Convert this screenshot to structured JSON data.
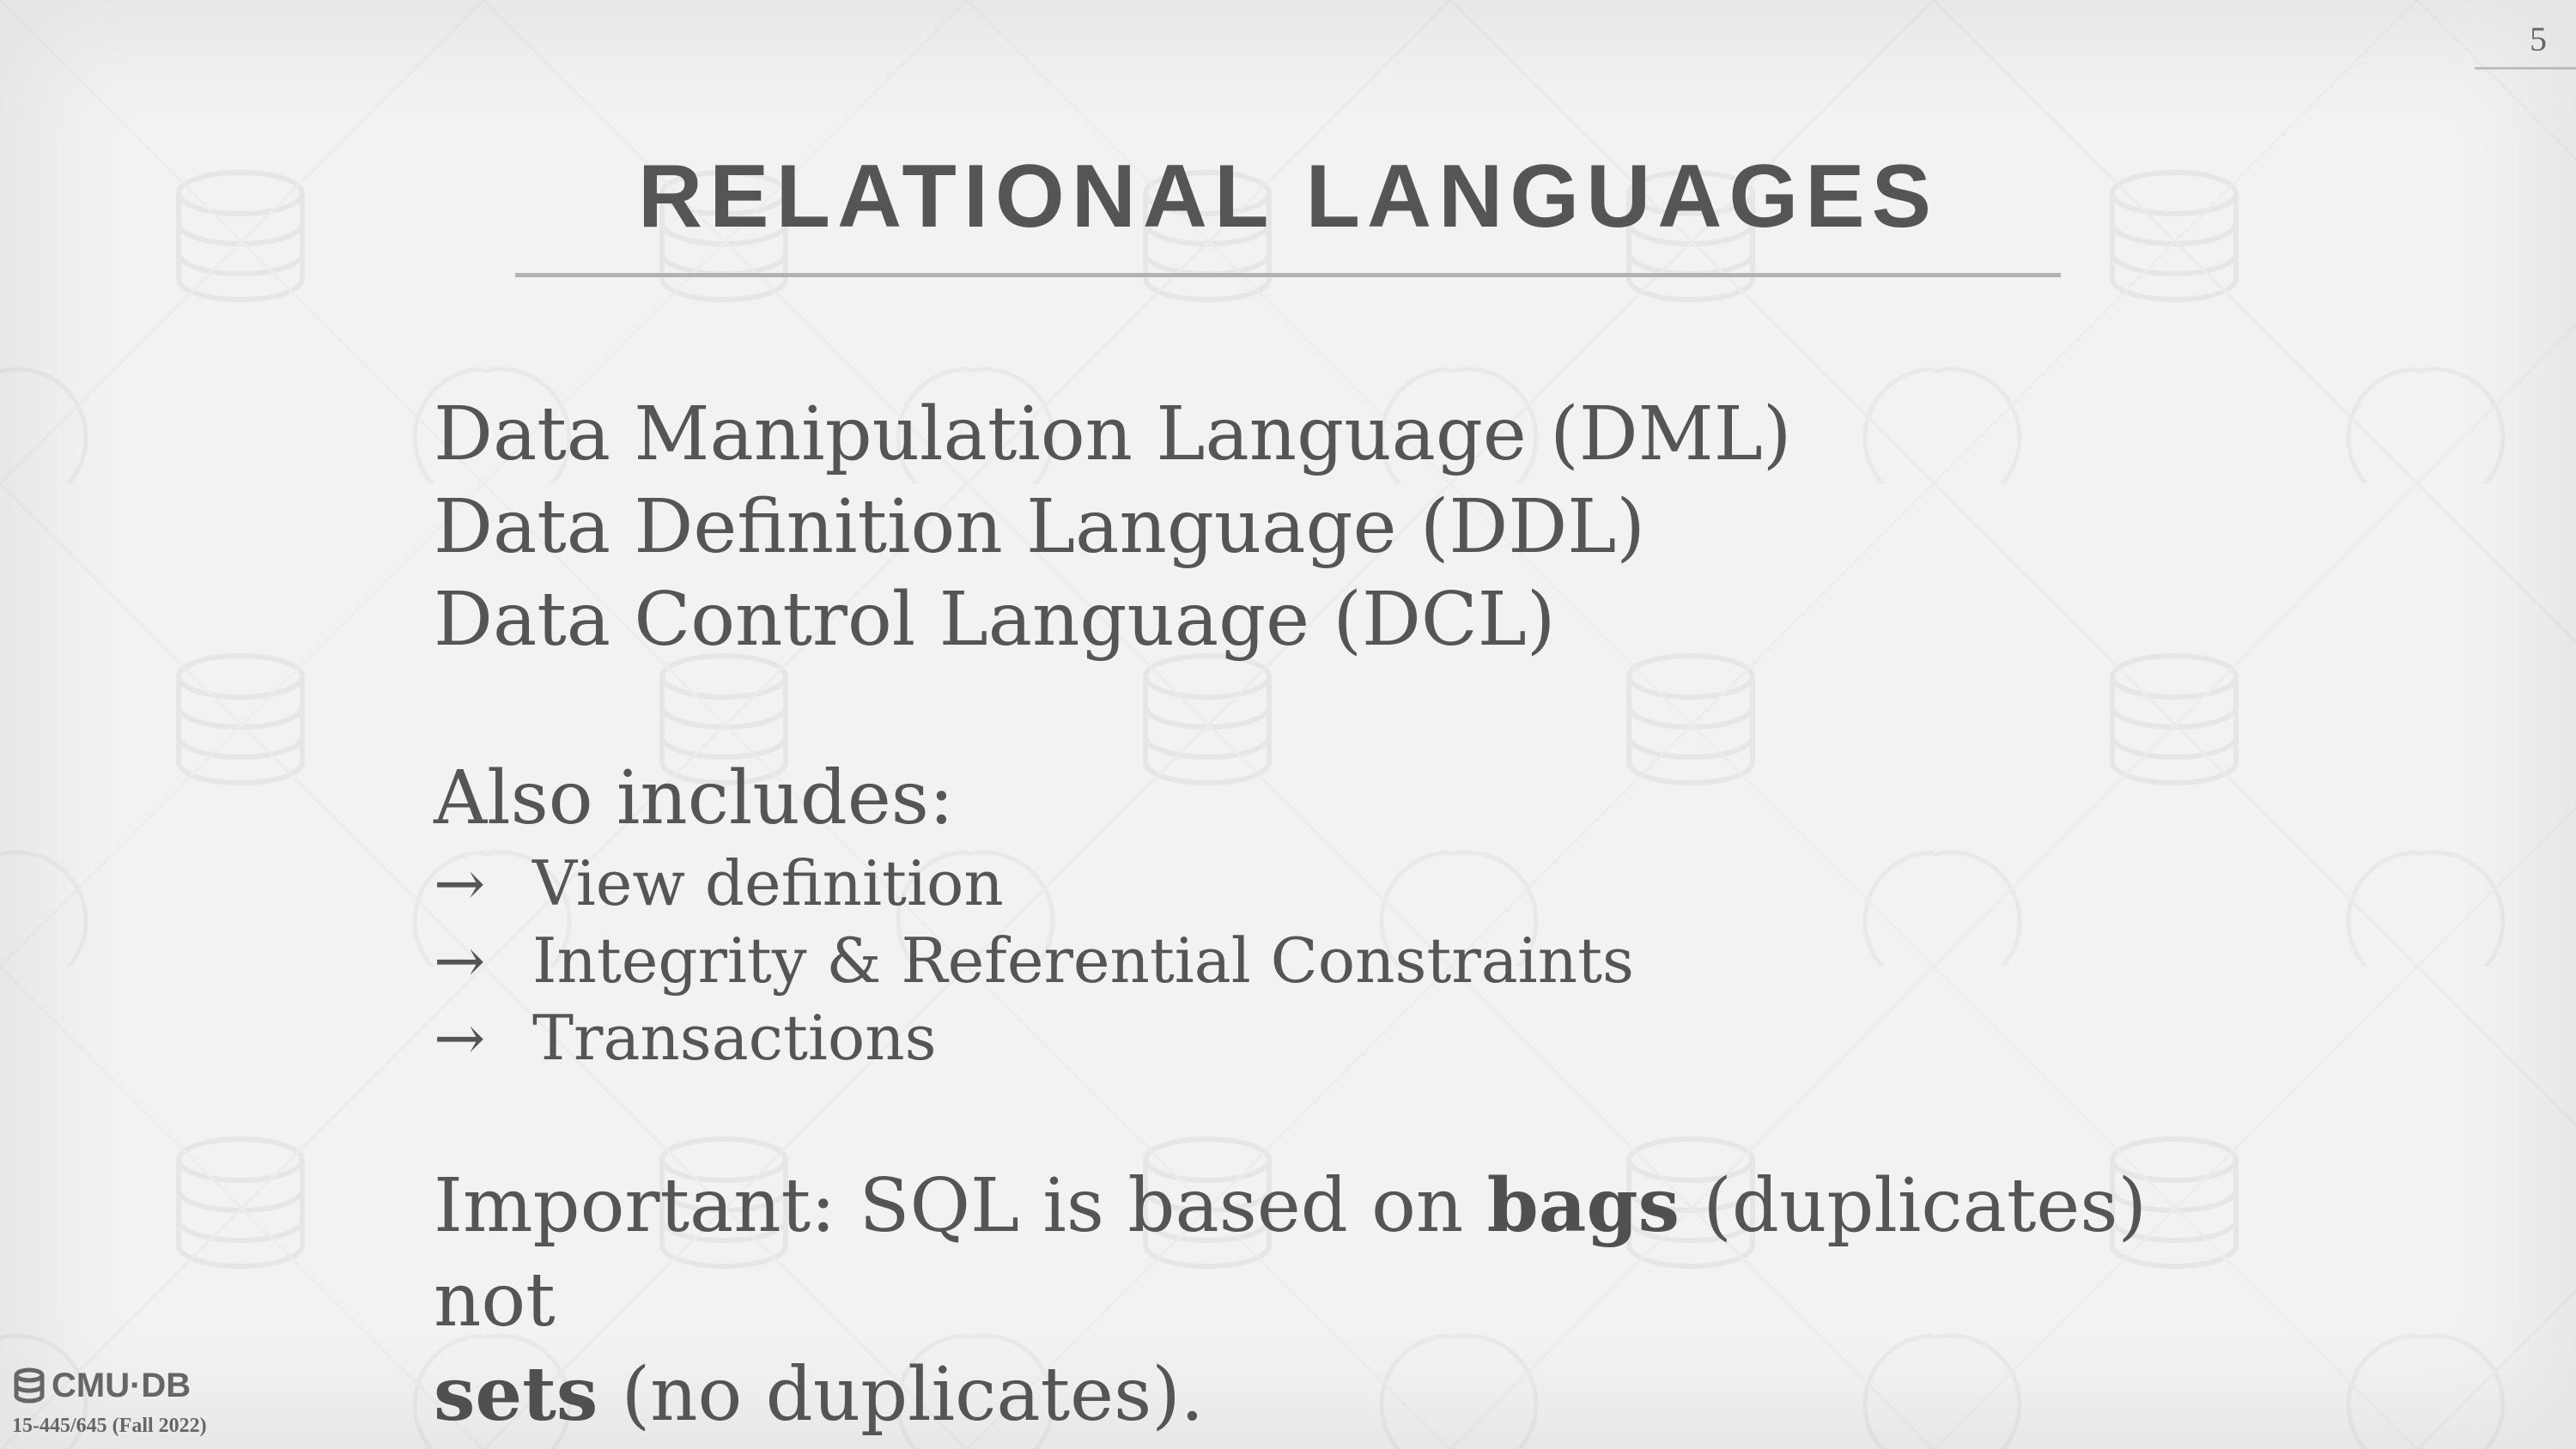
{
  "slide": {
    "page_number": "5",
    "title": "RELATIONAL LANGUAGES",
    "languages": [
      "Data Manipulation Language (DML)",
      "Data Definition Language (DDL)",
      "Data Control Language (DCL)"
    ],
    "also_heading": "Also includes:",
    "also_items": [
      {
        "arrow": "→",
        "text": "View definition"
      },
      {
        "arrow": "→",
        "text": "Integrity & Referential Constraints"
      },
      {
        "arrow": "→",
        "text": "Transactions"
      }
    ],
    "important": {
      "prefix": "Important: SQL is based on ",
      "bags": "bags",
      "middle": " (duplicates) not ",
      "sets": "sets",
      "suffix": " (no duplicates)."
    }
  },
  "footer": {
    "logo_icon": "database-icon",
    "logo_text": "CMU·DB",
    "course": "15-445/645 (Fall 2022)"
  },
  "colors": {
    "background": "#f2f2f2",
    "text": "#555555",
    "rule": "#b3b3b3"
  }
}
